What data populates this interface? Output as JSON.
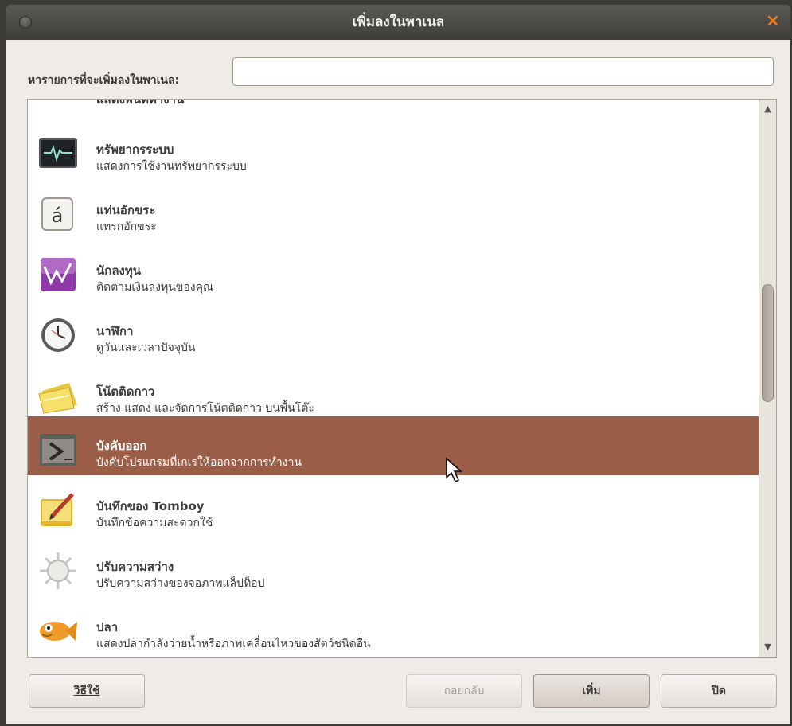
{
  "window": {
    "title": "เพิ่มลงในพาเนล",
    "close_glyph": "×"
  },
  "search": {
    "label": "หารายการที่จะเพิ่มลงในพาเนล:",
    "value": "",
    "placeholder": ""
  },
  "list": {
    "items": [
      {
        "name": "แสดงพื้นที่ทำงาน",
        "desc": "",
        "icon": "red-circle-icon",
        "selected": false
      },
      {
        "name": "ทรัพยากรระบบ",
        "desc": "แสดงการใช้งานทรัพยากรระบบ",
        "icon": "system-monitor-icon",
        "selected": false
      },
      {
        "name": "แท่นอักขระ",
        "desc": "แทรกอักขระ",
        "icon": "character-palette-icon",
        "selected": false
      },
      {
        "name": "นักลงทุน",
        "desc": "ติดตามเงินลงทุนของคุณ",
        "icon": "investor-chart-icon",
        "selected": false
      },
      {
        "name": "นาฬิกา",
        "desc": "ดูวันและเวลาปัจจุบัน",
        "icon": "clock-icon",
        "selected": false
      },
      {
        "name": "โน้ตติดกาว",
        "desc": "สร้าง แสดง และจัดการโน้ตติดกาว บนพื้นโต๊ะ",
        "icon": "sticky-notes-icon",
        "selected": false
      },
      {
        "name": "บังคับออก",
        "desc": "บังคับโปรแกรมที่เกเรให้ออกจากการทำงาน",
        "icon": "force-quit-icon",
        "selected": true
      },
      {
        "name": "บันทึกของ Tomboy",
        "desc": "บันทึกข้อความสะดวกใช้",
        "icon": "tomboy-notes-icon",
        "selected": false
      },
      {
        "name": "ปรับความสว่าง",
        "desc": "ปรับความสว่างของจอภาพแล็ปท็อป",
        "icon": "brightness-icon",
        "selected": false
      },
      {
        "name": "ปลา",
        "desc": "แสดงปลากำลังว่ายน้ำหรือภาพเคลื่อนไหวของสัตว์ชนิดอื่น",
        "icon": "fish-icon",
        "selected": false
      }
    ]
  },
  "scrollbar": {
    "up_glyph": "▲",
    "down_glyph": "▼"
  },
  "buttons": {
    "help": "วิธีใช้",
    "revert": "ถอยกลับ",
    "add": "เพิ่ม",
    "close": "ปิด"
  },
  "colors": {
    "selection": "#9a5d47",
    "titlebar": "#3e3d3a",
    "close_accent": "#f07d1d"
  }
}
